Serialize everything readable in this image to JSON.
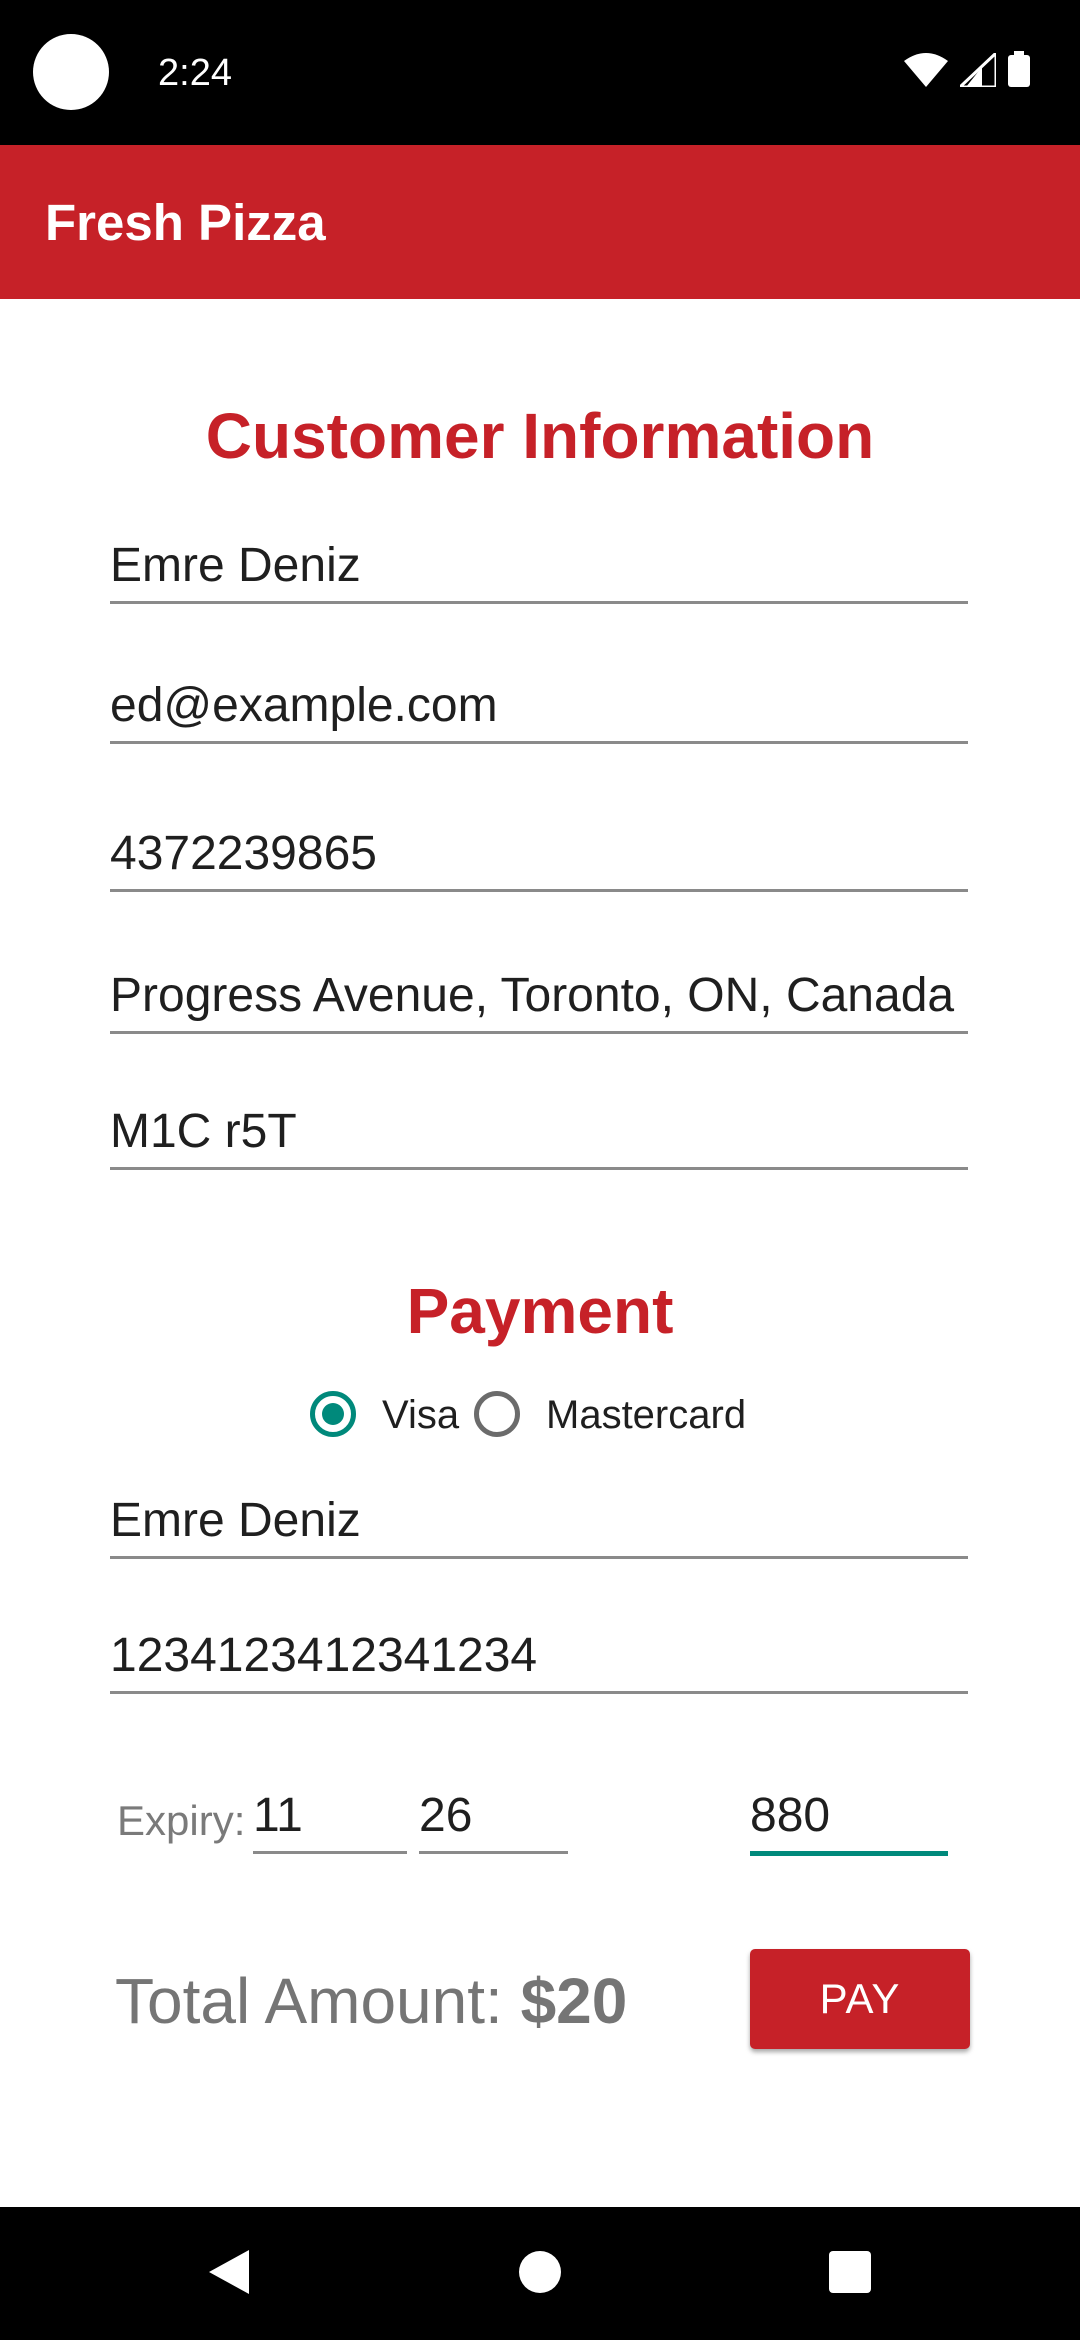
{
  "status_bar": {
    "time": "2:24"
  },
  "app_bar": {
    "title": "Fresh Pizza"
  },
  "customer": {
    "heading": "Customer Information",
    "name": "Emre Deniz",
    "email": "ed@example.com",
    "phone": "4372239865",
    "address": "Progress Avenue, Toronto, ON, Canada",
    "postal_code": "M1C r5T"
  },
  "payment": {
    "heading": "Payment",
    "card_types": [
      {
        "label": "Visa",
        "selected": true
      },
      {
        "label": "Mastercard",
        "selected": false
      }
    ],
    "cardholder_name": "Emre Deniz",
    "card_number": "1234123412341234",
    "expiry_label": "Expiry:",
    "expiry_month": "11",
    "expiry_year": "26",
    "cvv": "880"
  },
  "total": {
    "label": "Total Amount:",
    "amount": "$20"
  },
  "pay_button": {
    "label": "PAY"
  },
  "colors": {
    "brand_red": "#C62128",
    "accent_teal": "#00897B"
  },
  "icons": [
    "wifi-icon",
    "cell-signal-icon",
    "battery-icon",
    "back-icon",
    "home-icon",
    "recents-icon"
  ]
}
